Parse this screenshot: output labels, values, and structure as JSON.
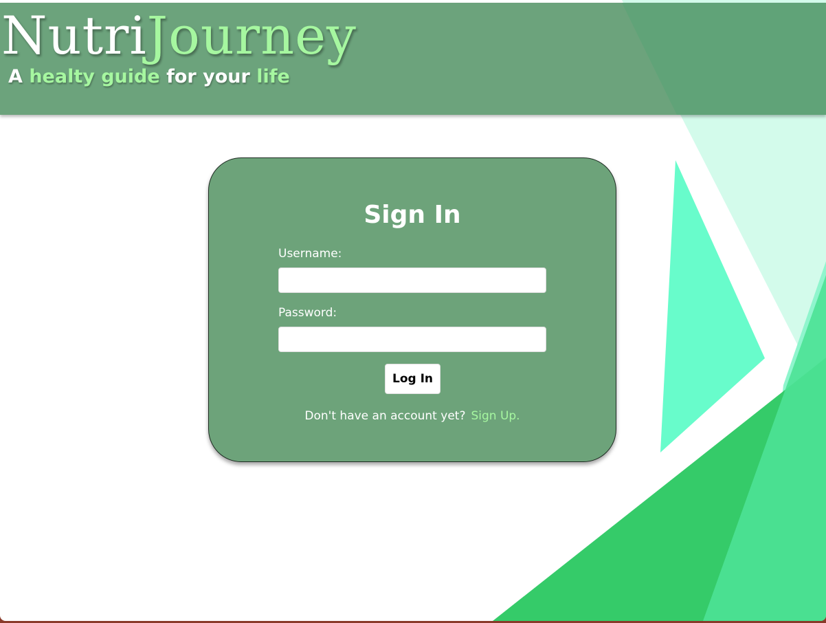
{
  "brand": {
    "name_part1": "Nutri",
    "name_part2": "Journey",
    "tagline": {
      "a": "A",
      "healty_guide": "healty guide",
      "for_your": "for your",
      "life": "life"
    }
  },
  "signin": {
    "title": "Sign In",
    "username_label": "Username:",
    "username_value": "",
    "password_label": "Password:",
    "password_value": "",
    "login_button": "Log In",
    "no_account_text": "Don't have an account yet?",
    "signup_link": "Sign Up."
  },
  "colors": {
    "header": "#6ca37c",
    "card": "#6da37a",
    "accent_light_green": "#a6f7a0",
    "mint": "#68fccb",
    "green": "#35cb69"
  }
}
